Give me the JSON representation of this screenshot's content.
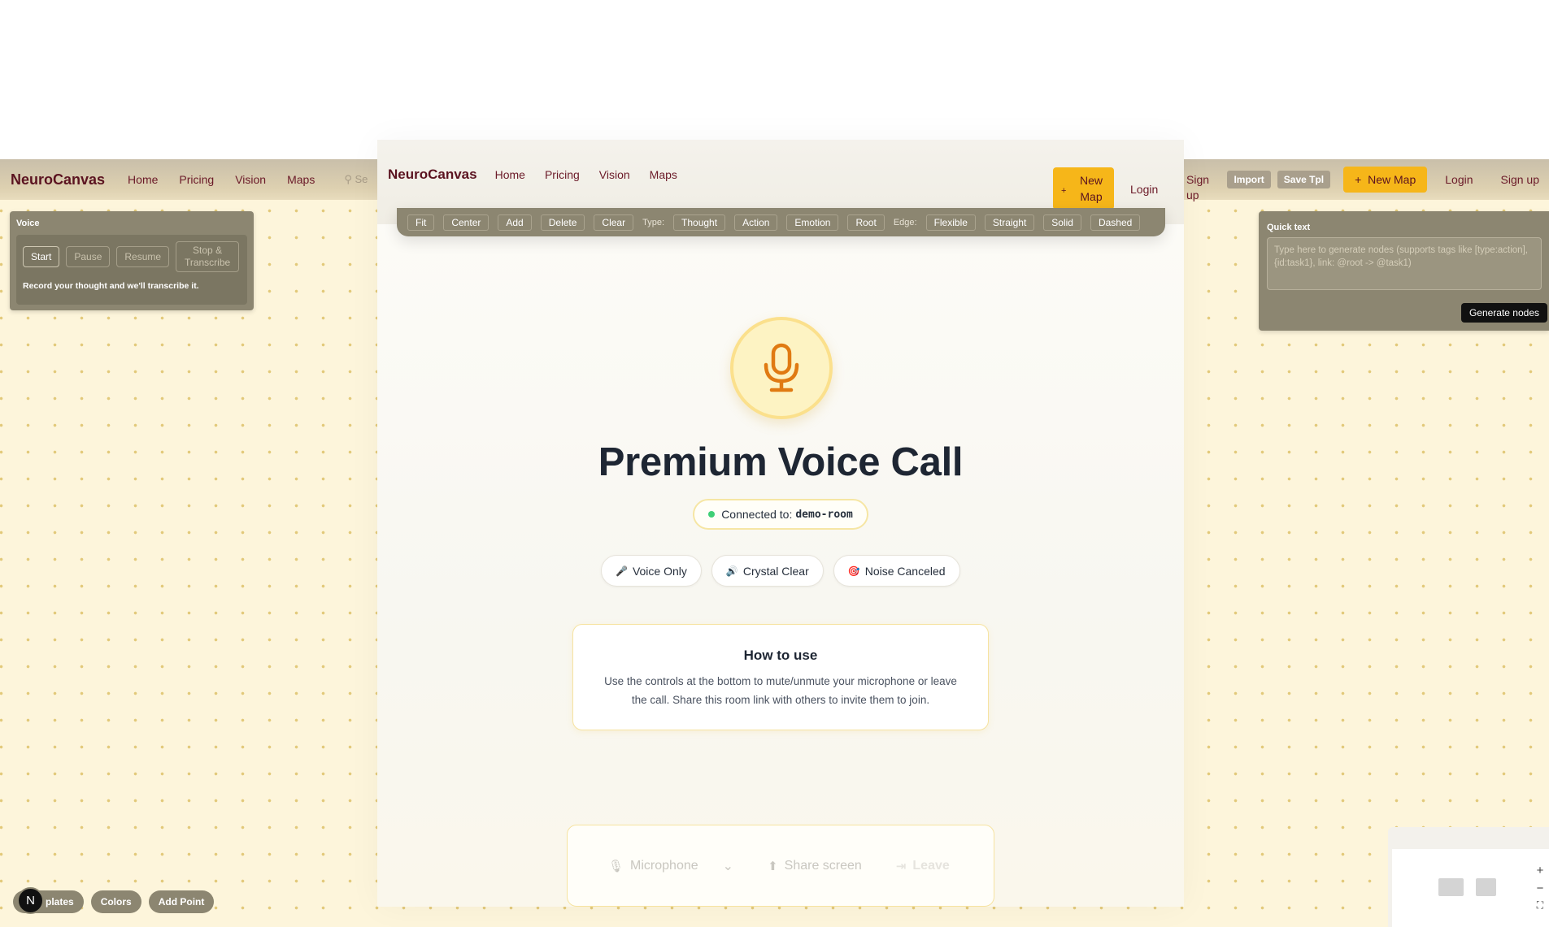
{
  "bg": {
    "brand": "NeuroCanvas",
    "nav": [
      "Home",
      "Pricing",
      "Vision",
      "Maps"
    ],
    "search_placeholder": "Se",
    "chips": [
      "Import",
      "Save Tpl"
    ],
    "new_map": "New Map",
    "login": "Login",
    "signup": "Sign up"
  },
  "voice_panel": {
    "title": "Voice",
    "buttons": [
      "Start",
      "Pause",
      "Resume",
      "Stop & Transcribe"
    ],
    "hint": "Record your thought and we'll transcribe it."
  },
  "quick_text": {
    "title": "Quick text",
    "placeholder": "Type here to generate nodes (supports tags like [type:action], {id:task1}, link: @root -> @task1)",
    "generate": "Generate nodes"
  },
  "bottom_chips": [
    "plates",
    "Colors",
    "Add Point"
  ],
  "avatar_letter": "N",
  "modal": {
    "nav": {
      "brand": "NeuroCanvas",
      "links": [
        "Home",
        "Pricing",
        "Vision",
        "Maps"
      ],
      "new_map": "New Map",
      "login": "Login",
      "signup": "Sign up"
    },
    "toolbar": {
      "buttons_a": [
        "Fit",
        "Center",
        "Add",
        "Delete",
        "Clear"
      ],
      "type_label": "Type:",
      "types": [
        "Thought",
        "Action",
        "Emotion",
        "Root"
      ],
      "edge_label": "Edge:",
      "edges": [
        "Flexible",
        "Straight",
        "Solid",
        "Dashed"
      ]
    },
    "title": "Premium Voice Call",
    "connected_label": "Connected to:",
    "room": "demo-room",
    "features": [
      {
        "icon": "🎤",
        "label": "Voice Only"
      },
      {
        "icon": "🔊",
        "label": "Crystal Clear"
      },
      {
        "icon": "🎯",
        "label": "Noise Canceled"
      }
    ],
    "howto": {
      "title": "How to use",
      "text": "Use the controls at the bottom to mute/unmute your microphone or leave the call. Share this room link with others to invite them to join."
    },
    "controls": {
      "microphone": "Microphone",
      "share": "Share screen",
      "leave": "Leave"
    }
  },
  "colors": {
    "brand": "#5b1320",
    "accent": "#f6b619",
    "canvas": "#fdf5db",
    "panel": "#8c8671",
    "online": "#3ecf76"
  }
}
